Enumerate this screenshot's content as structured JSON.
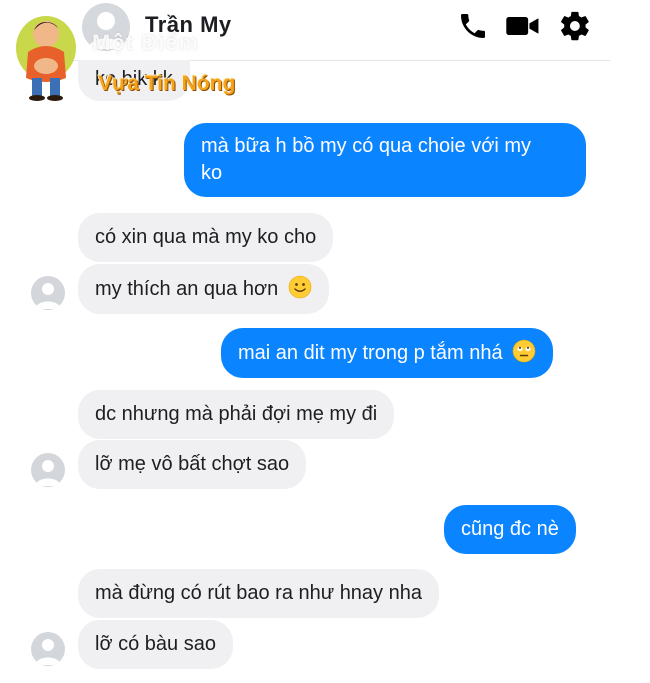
{
  "header": {
    "contact_name": "Trần My",
    "icons": [
      "phone-icon",
      "video-camera-icon",
      "gear-icon"
    ]
  },
  "watermark": {
    "top_text": "Một Điểm",
    "brand": "Vựa Tin Nóng"
  },
  "messages": [
    {
      "from": "contact",
      "text": "ko bik kk"
    },
    {
      "from": "me",
      "lines": [
        "mà bữa h bồ my có qua choie với my",
        "ko"
      ]
    },
    {
      "from": "contact",
      "text": "có xin qua mà my ko cho"
    },
    {
      "from": "contact",
      "text": "my thích an qua hơn",
      "emoji": "slightly-smiling-face-emoji"
    },
    {
      "from": "me",
      "text": "mai an dit my trong p tắm nhá",
      "emoji": "eye-roll-face-emoji"
    },
    {
      "from": "contact",
      "text": "dc nhưng mà phải đợi mẹ my đi"
    },
    {
      "from": "contact",
      "text": "lỡ mẹ vô bất chợt sao"
    },
    {
      "from": "me",
      "text": "cũng đc nè"
    },
    {
      "from": "contact",
      "text": "mà đừng có rút bao ra như hnay nha"
    },
    {
      "from": "contact",
      "text": "lỡ có bàu sao"
    }
  ],
  "colors": {
    "outgoing_bubble": "#0b84ff",
    "incoming_bubble": "#f0f0f2",
    "brand_orange": "#f5a31a"
  }
}
